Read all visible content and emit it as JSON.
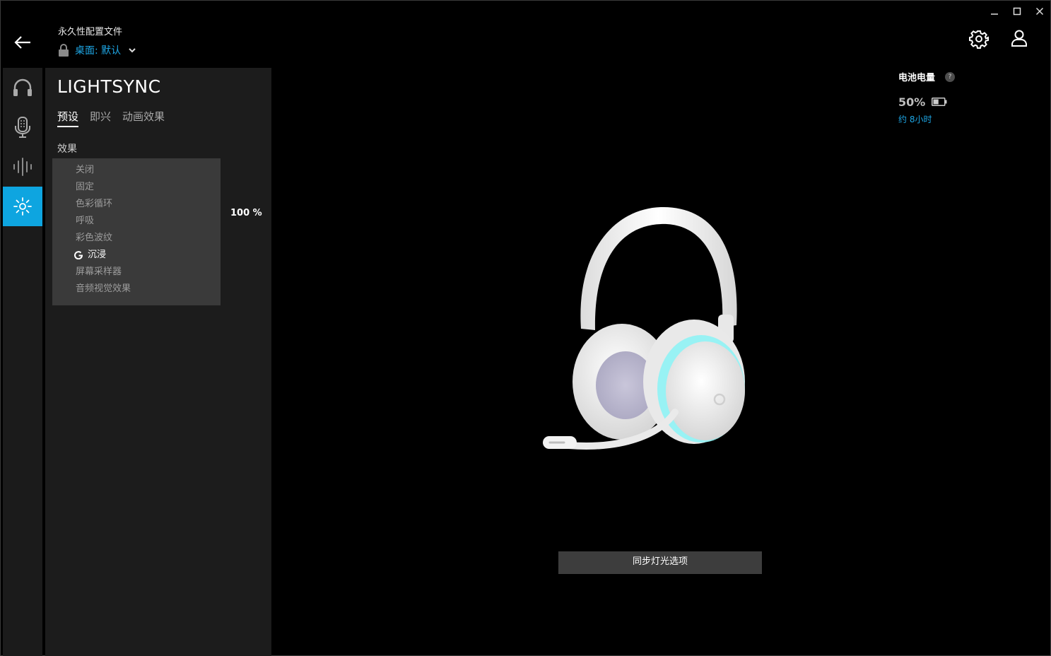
{
  "window": {
    "minimize_icon": "minimize-icon",
    "maximize_icon": "maximize-icon",
    "close_icon": "close-icon"
  },
  "header": {
    "back_icon": "arrow-left-icon",
    "profile_caption": "永久性配置文件",
    "profile_name": "桌面: 默认",
    "lock_icon": "lock-icon",
    "dropdown_icon": "chevron-down-icon",
    "settings_icon": "gear-icon",
    "account_icon": "user-icon"
  },
  "sidebar": {
    "items": [
      {
        "icon": "headphones-icon",
        "active": false
      },
      {
        "icon": "microphone-icon",
        "active": false
      },
      {
        "icon": "equalizer-icon",
        "active": false
      },
      {
        "icon": "lighting-icon",
        "active": true
      }
    ]
  },
  "panel": {
    "title": "LIGHTSYNC",
    "tabs": [
      {
        "label": "预设",
        "active": true
      },
      {
        "label": "即兴",
        "active": false
      },
      {
        "label": "动画效果",
        "active": false
      }
    ],
    "effect_label": "效果",
    "effects": [
      {
        "label": "关闭",
        "selected": false
      },
      {
        "label": "固定",
        "selected": false
      },
      {
        "label": "色彩循环",
        "selected": false
      },
      {
        "label": "呼吸",
        "selected": false
      },
      {
        "label": "彩色波纹",
        "selected": false
      },
      {
        "label": "沉浸",
        "selected": true
      },
      {
        "label": "屏幕采样器",
        "selected": false
      },
      {
        "label": "音频视觉效果",
        "selected": false
      }
    ],
    "brightness_readout": "100 %"
  },
  "battery": {
    "label": "电池电量",
    "help_glyph": "?",
    "percent": "50%",
    "level": 0.5,
    "remaining": "约 8小时"
  },
  "device": {
    "image": "headset-image",
    "lighting_color": "#8ff3f5"
  },
  "sync_button": "同步灯光选项",
  "colors": {
    "accent": "#0ea5e0",
    "link": "#1ea7e6",
    "panel": "#1c1c1c",
    "dropdown": "#3a3a3a"
  }
}
